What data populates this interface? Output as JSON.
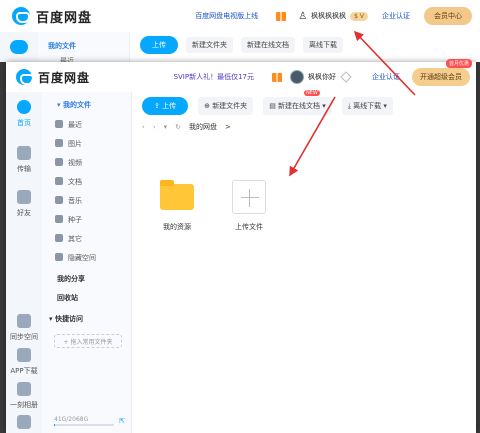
{
  "back_window": {
    "logo": "百度网盘",
    "tv_link": "百度网盘电视版上线",
    "username": "枫枫枫枫枫",
    "vip_badge": "$ V",
    "auth": "企业认证",
    "member_center": "会员中心",
    "nav_my_files": "我的文件",
    "nav_recent": "最近",
    "upload": "上传",
    "new_folder": "新建文件夹",
    "new_online_doc": "新建在线文档",
    "offline_download": "离线下载"
  },
  "header": {
    "logo": "百度网盘",
    "svip_promo": "SVIP新人礼！最低仅17元",
    "username": "枫枫你好",
    "auth": "企业认证",
    "vip_button": "开通超级会员",
    "vip_tag": "首月优惠"
  },
  "rail": {
    "home": "首页",
    "transfer": "传输",
    "friends": "好友",
    "sync_space": "同步空间",
    "app_download": "APP下载",
    "one_click_record": "一刻相册",
    "tools": "工具"
  },
  "nav": {
    "my_files": "我的文件",
    "items": [
      "最近",
      "图片",
      "视频",
      "文档",
      "音乐",
      "种子",
      "其它",
      "隐藏空间"
    ],
    "my_share": "我的分享",
    "recycle_bin": "回收站",
    "quick_access": "快捷访问",
    "add_quick": "+ 拖入常用文件夹",
    "storage": "41G/2068G",
    "storage_fraction": 0.02
  },
  "toolbar": {
    "upload": "上传",
    "new_folder": "新建文件夹",
    "new_online_doc": "新建在线文档",
    "new_badge": "NEW",
    "offline_download": "离线下载"
  },
  "breadcrumb": {
    "current": "我的网盘",
    "sep": ">"
  },
  "files": [
    {
      "name": "我的资源",
      "type": "folder"
    },
    {
      "name": "上传文件",
      "type": "upload"
    }
  ],
  "colors": {
    "accent": "#06a7ff",
    "arrow": "#e03030",
    "vip": "#f5cd8f"
  }
}
